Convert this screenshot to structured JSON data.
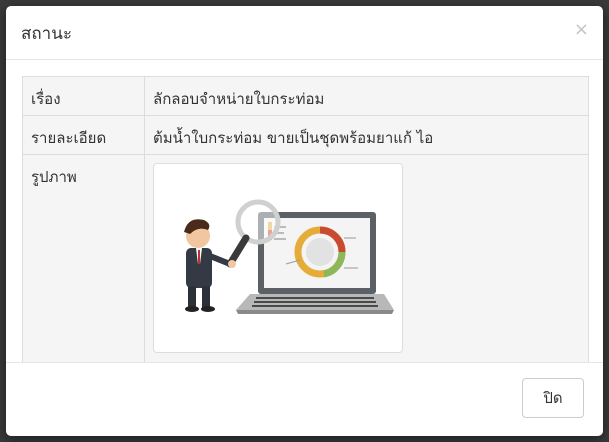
{
  "modal": {
    "title": "สถานะ",
    "close_icon": "×"
  },
  "details": [
    {
      "label": "เรื่อง",
      "value": "ลักลอบจำหน่ายใบกระท่อม"
    },
    {
      "label": "รายละเอียด",
      "value": "ต้มน้ำใบกระท่อม ขายเป็นชุดพร้อมยาแก้ ไอ"
    },
    {
      "label": "รูปภาพ",
      "value": ""
    }
  ],
  "image": {
    "icon": "businessman-magnifier-laptop-chart-illustration"
  },
  "footer": {
    "close_label": "ปิด"
  },
  "colors": {
    "overlay": "#3a3a3a",
    "cell_bg": "#f5f5f5",
    "border": "#dddddd"
  }
}
